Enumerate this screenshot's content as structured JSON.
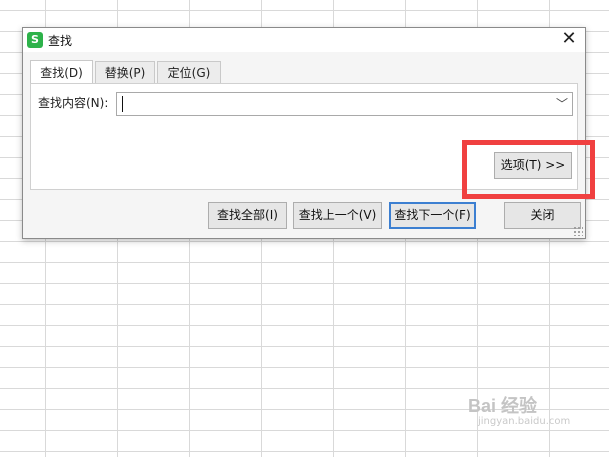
{
  "dialog": {
    "title": "查找",
    "app_icon_letter": "S",
    "close_symbol": "✕",
    "tabs": [
      {
        "label": "查找(D)"
      },
      {
        "label": "替换(P)"
      },
      {
        "label": "定位(G)"
      }
    ],
    "find_label": "查找内容(N):",
    "find_value": "",
    "combo_arrow": "﹀",
    "options_button": "选项(T) >>",
    "buttons": {
      "find_all": "查找全部(I)",
      "find_prev": "查找上一个(V)",
      "find_next": "查找下一个(F)",
      "close": "关闭"
    }
  },
  "watermark": {
    "brand": "Bai 经验",
    "sub": "jingyan.baidu.com"
  },
  "colors": {
    "highlight": "#f04040",
    "app_icon": "#2db24a",
    "default_button_border": "#3c7fd1"
  }
}
